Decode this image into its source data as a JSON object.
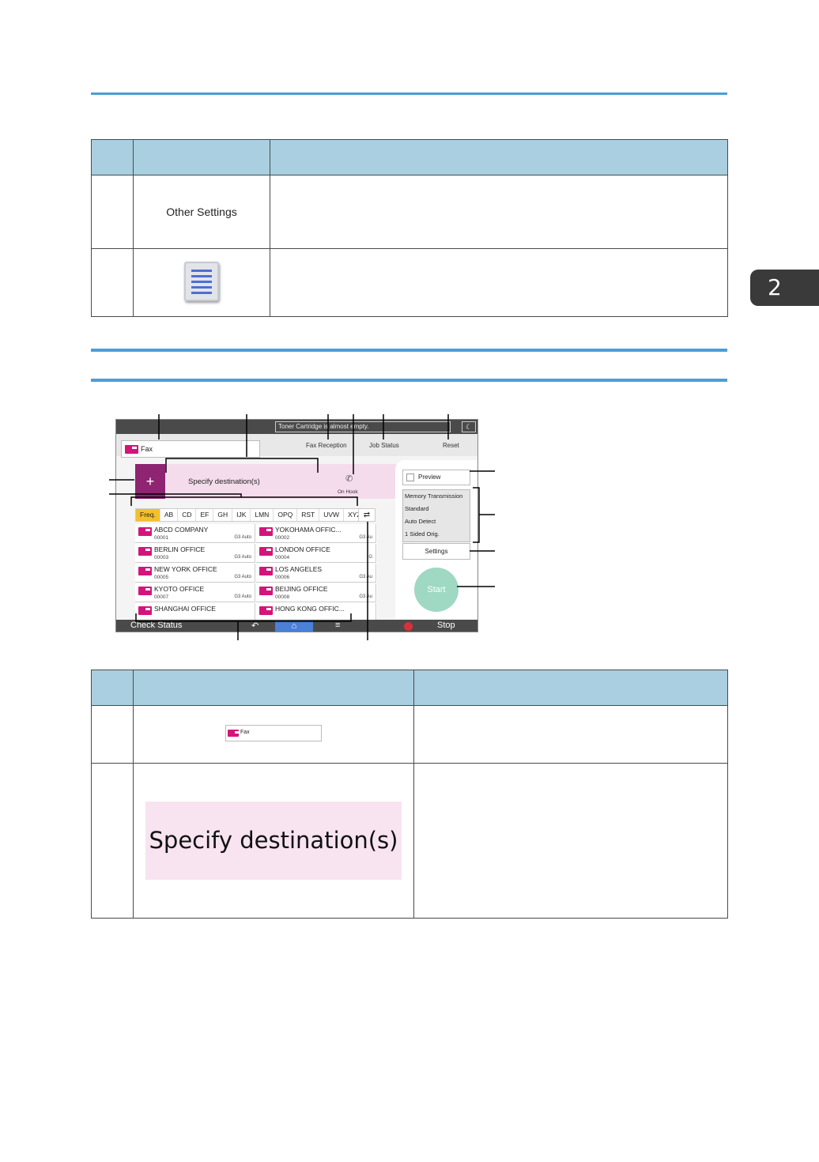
{
  "page": {
    "chapter_number": "2"
  },
  "table1": {
    "rows": [
      {
        "label": "Other Settings",
        "icon": "menu-list-icon"
      },
      {
        "label": "",
        "icon": "menu-list-icon"
      }
    ]
  },
  "screen": {
    "toner_message": "Toner Cartridge is almost empty.",
    "app_name": "Fax",
    "nav": {
      "fax_reception": "Fax Reception",
      "job_status": "Job Status",
      "reset": "Reset"
    },
    "destination_placeholder": "Specify destination(s)",
    "on_hook": "On Hook",
    "tabs": [
      "Freq.",
      "AB",
      "CD",
      "EF",
      "GH",
      "IJK",
      "LMN",
      "OPQ",
      "RST",
      "UVW",
      "XYZ"
    ],
    "destinations": [
      {
        "name": "ABCD COMPANY",
        "number": "00001",
        "mode": "G3 Auto"
      },
      {
        "name": "YOKOHAMA OFFIC...",
        "number": "00002",
        "mode": "G3 Au"
      },
      {
        "name": "BERLIN OFFICE",
        "number": "00003",
        "mode": "G3 Auto"
      },
      {
        "name": "LONDON OFFICE",
        "number": "00004",
        "mode": "G"
      },
      {
        "name": "NEW YORK OFFICE",
        "number": "00005",
        "mode": "G3 Auto"
      },
      {
        "name": "LOS ANGELES",
        "number": "00006",
        "mode": "G3 Au"
      },
      {
        "name": "KYOTO OFFICE",
        "number": "00007",
        "mode": "G3 Auto"
      },
      {
        "name": "BEIJING OFFICE",
        "number": "00008",
        "mode": "G3 Au"
      },
      {
        "name": "SHANGHAI  OFFICE",
        "number": "",
        "mode": ""
      },
      {
        "name": "HONG KONG OFFIC...",
        "number": "",
        "mode": ""
      }
    ],
    "preview": "Preview",
    "settings_summary": [
      "Memory Transmission",
      "Standard",
      "Auto Detect",
      "1 Sided Orig."
    ],
    "settings_button": "Settings",
    "start": "Start",
    "check_status": "Check Status",
    "stop": "Stop"
  },
  "table2": {
    "row1_image_label": "Fax",
    "row2_image_label": "Specify destination(s)"
  },
  "colors": {
    "rule_blue": "#4a9fd8",
    "header_blue": "#a9cfe0",
    "fax_magenta": "#d4147a",
    "add_purple": "#8e2472",
    "dest_pink": "#f5dcec",
    "freq_yellow": "#f5bf2a",
    "start_green": "#9fd8c3"
  }
}
